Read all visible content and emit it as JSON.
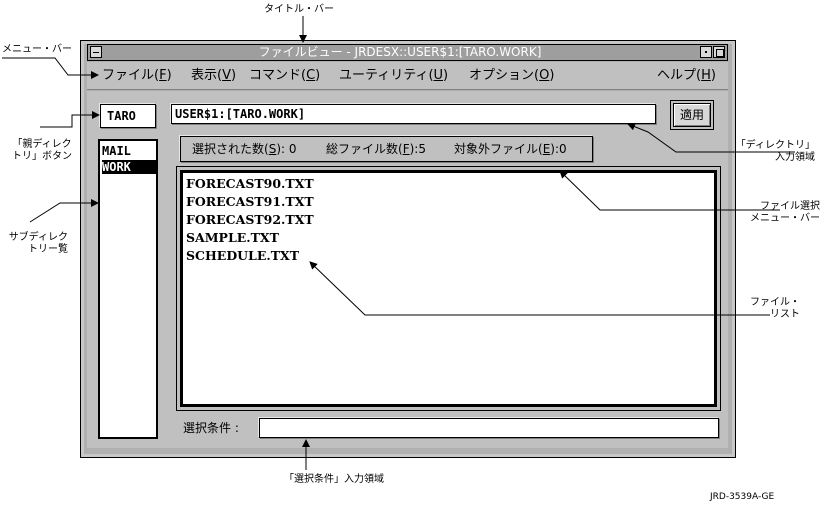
{
  "callouts": {
    "title_bar": "タイトル・バー",
    "menu_bar": "メニュー・バー",
    "parent_dir_button": [
      "「親ディレク",
      "トリ」ボタン"
    ],
    "subdir_list": [
      "サブディレク",
      "トリー覧"
    ],
    "dir_input": [
      "「ディレクトリ」",
      "入力領域"
    ],
    "file_select_menu": [
      "ファイル選択",
      "メニュー・バー"
    ],
    "file_list": [
      "ファイル・",
      "リスト"
    ],
    "filter_input": "「選択条件」入力領域",
    "figure_id": "JRD-3539A-GE"
  },
  "window": {
    "title": "ファイルビュー - JRDESX::USER$1:[TARO.WORK]"
  },
  "menu": [
    {
      "label": "ファイル",
      "key": "F"
    },
    {
      "label": "表示",
      "key": "V"
    },
    {
      "label": "コマンド",
      "key": "C"
    },
    {
      "label": "ユーティリティ",
      "key": "U"
    },
    {
      "label": "オプション",
      "key": "O"
    },
    {
      "label": "ヘルプ",
      "key": "H"
    }
  ],
  "parent_button": "TARO",
  "directory_input": "USER$1:[TARO.WORK]",
  "apply_button": "適用",
  "counts": {
    "selected_label": "選択された数",
    "selected_key": "S",
    "selected_value": "0",
    "total_label": "総ファイル数",
    "total_key": "F",
    "total_value": "5",
    "excluded_label": "対象外ファイル",
    "excluded_key": "E",
    "excluded_value": "0"
  },
  "subdirs": [
    "MAIL",
    "WORK"
  ],
  "files": [
    "FORECAST90.TXT",
    "FORECAST91.TXT",
    "FORECAST92.TXT",
    "SAMPLE.TXT",
    "SCHEDULE.TXT"
  ],
  "filter": {
    "label": "選択条件 :",
    "value": ""
  }
}
